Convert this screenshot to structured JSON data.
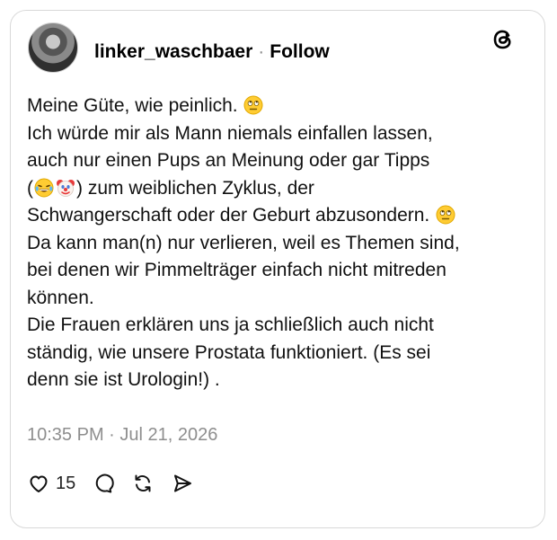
{
  "post": {
    "username": "linker_waschbaer",
    "separator": "·",
    "follow_label": "Follow",
    "body_lines": [
      "Meine Güte, wie peinlich.",
      "Ich würde mir als Mann niemals einfallen lassen,",
      "auch nur einen Pups an Meinung oder gar Tipps",
      ") zum weiblichen Zyklus, der",
      "Schwangerschaft oder der Geburt abzusondern.",
      "Da kann man(n) nur verlieren, weil es Themen sind,",
      "bei denen wir Pimmelträger einfach nicht mitreden",
      "können.",
      "Die Frauen erklären uns ja schließlich auch nicht",
      "ständig, wie unsere Prostata funktioniert. (Es sei",
      "denn sie ist Urologin!) ."
    ],
    "paren_open": "(",
    "timestamp": "10:35 PM · Jul 21, 2026",
    "like_count": "15"
  },
  "icons": {
    "logo": "threads-logo-icon",
    "eye_roll": "face-with-rolling-eyes-emoji",
    "laughing": "face-with-tears-of-joy-emoji",
    "clown": "clown-face-emoji",
    "like": "heart-icon",
    "reply": "comment-bubble-icon",
    "repost": "repost-icon",
    "share": "send-icon"
  },
  "colors": {
    "meta_gray": "#8e8e8e",
    "border": "#d9d9d9"
  }
}
